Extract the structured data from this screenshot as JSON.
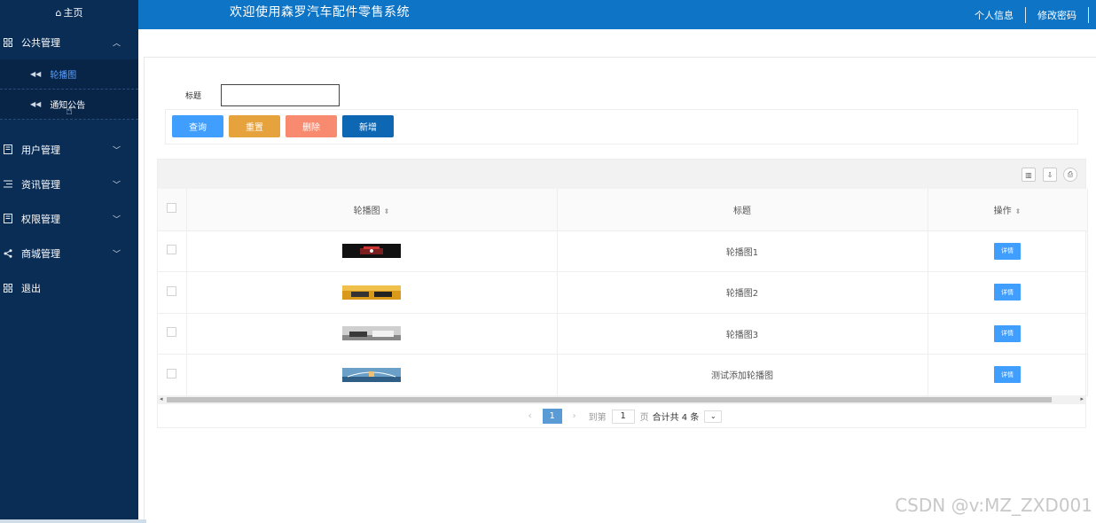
{
  "sidebar": {
    "home_label": "主页",
    "menus": [
      {
        "label": "公共管理",
        "icon": "grid-icon",
        "expanded": true
      },
      {
        "label": "用户管理",
        "icon": "book-icon",
        "expanded": false
      },
      {
        "label": "资讯管理",
        "icon": "list-icon",
        "expanded": false
      },
      {
        "label": "权限管理",
        "icon": "book-icon",
        "expanded": false
      },
      {
        "label": "商城管理",
        "icon": "share-icon",
        "expanded": false
      },
      {
        "label": "退出",
        "icon": "grid-icon"
      }
    ],
    "submenu": [
      {
        "label": "轮播图",
        "active": true
      },
      {
        "label": "通知公告",
        "active": false
      }
    ]
  },
  "header": {
    "title": "欢迎使用森罗汽车配件零售系统",
    "profile_label": "个人信息",
    "password_label": "修改密码"
  },
  "search": {
    "label": "标题",
    "value": ""
  },
  "buttons": {
    "query": "查询",
    "reset": "重置",
    "delete": "删除",
    "add": "新增"
  },
  "table": {
    "headers": [
      "轮播图",
      "标题",
      "操作"
    ],
    "rows": [
      {
        "title": "轮播图1",
        "action": "详情"
      },
      {
        "title": "轮播图2",
        "action": "详情"
      },
      {
        "title": "轮播图3",
        "action": "详情"
      },
      {
        "title": "测试添加轮播图",
        "action": "详情"
      }
    ]
  },
  "pager": {
    "current": "1",
    "goto_label": "到第",
    "goto_value": "1",
    "page_unit": "页",
    "total": "合计共 4 条"
  },
  "watermark": "CSDN @v:MZ_ZXD001",
  "colors": {
    "sidebar": "#0a2d56",
    "header": "#0e74c6",
    "query": "#409eff",
    "reset": "#e6a23c",
    "delete": "#f78a6f",
    "add": "#0d67b3"
  }
}
